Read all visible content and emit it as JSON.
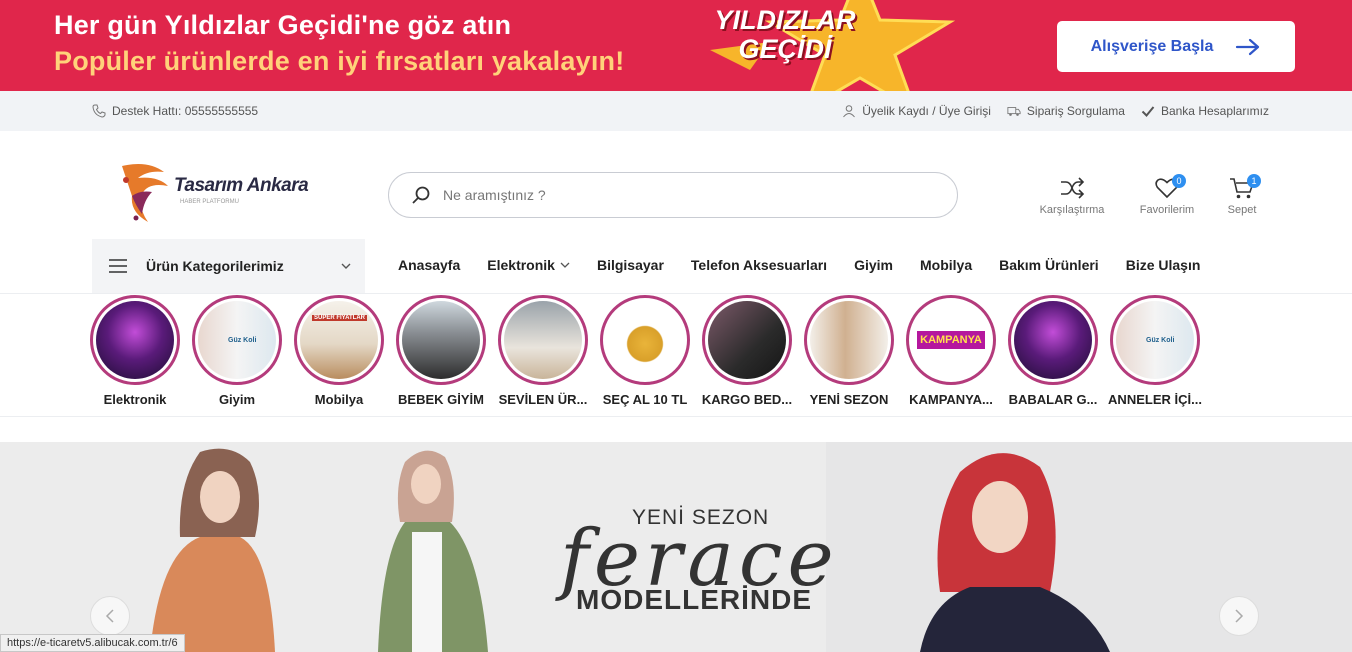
{
  "promo": {
    "line1": "Her gün Yıldızlar Geçidi'ne göz atın",
    "line2": "Popüler ürünlerde en iyi fırsatları yakalayın!",
    "badge_line1": "YILDIZLAR",
    "badge_line2": "GEÇİDİ",
    "cta_label": "Alışverişe Başla"
  },
  "topbar": {
    "support": "Destek Hattı: 05555555555",
    "links": [
      "Üyelik Kaydı / Üye Girişi",
      "Sipariş Sorgulama",
      "Banka Hesaplarımız"
    ]
  },
  "header": {
    "logo_name": "Tasarım Ankara",
    "logo_tag": "HABER PLATFORMU",
    "search_placeholder": "Ne aramıştınız ?",
    "compare_label": "Karşılaştırma",
    "favorites_label": "Favorilerim",
    "favorites_count": "0",
    "cart_label": "Sepet",
    "cart_count": "1"
  },
  "nav": {
    "categories_label": "Ürün Kategorilerimiz",
    "items": [
      "Anasayfa",
      "Elektronik",
      "Bilgisayar",
      "Telefon Aksesuarları",
      "Giyim",
      "Mobilya",
      "Bakım Ürünleri",
      "Bize Ulaşın"
    ]
  },
  "stories": [
    "Elektronik",
    "Giyim",
    "Mobilya",
    "BEBEK GİYİM",
    "SEVİLEN ÜR...",
    "SEÇ AL 10 TL",
    "KARGO BED...",
    "YENİ SEZON",
    "KAMPANYA...",
    "BABALAR G...",
    "ANNELER İÇİ..."
  ],
  "story_image_text": {
    "mobilya": "SÜPER FİYATLAR",
    "kampanya": "KAMPANYA",
    "giyim": "Güz Koli"
  },
  "hero": {
    "line1": "YENİ SEZON",
    "script": "ferace",
    "line2": "MODELLERİNDE"
  },
  "status_url": "https://e-ticaretv5.alibucak.com.tr/6",
  "colors": {
    "promo_bg": "#e0264b",
    "promo_accent": "#ffd27a",
    "cta_text": "#2f56c9",
    "story_ring": "#b43b7c",
    "badge": "#2e8ff0"
  }
}
